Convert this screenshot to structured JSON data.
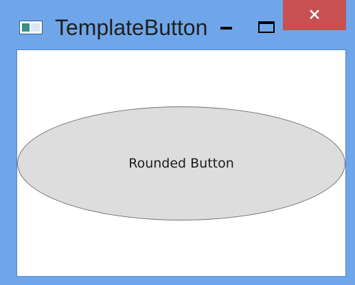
{
  "window": {
    "title": "TemplateButton",
    "controls": {
      "minimize_icon": "minimize-icon",
      "maximize_icon": "maximize-icon",
      "close_icon": "close-icon"
    }
  },
  "content": {
    "rounded_button_label": "Rounded Button"
  },
  "colors": {
    "frame": "#6fa6e9",
    "close_button": "#c75050",
    "button_fill": "#dddddd",
    "button_border": "#707070"
  }
}
